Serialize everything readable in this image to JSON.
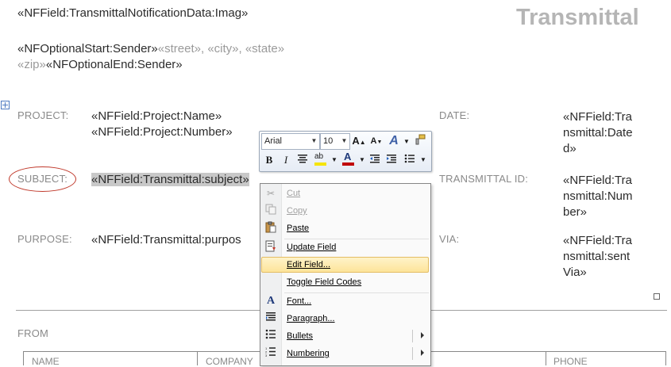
{
  "header": {
    "image_field": "«NFField:TransmittalNotificationData:Imag»",
    "title": "Transmittal",
    "sender_start": "«NFOptionalStart:Sender»",
    "street": "«street»,",
    "city": "«city»,",
    "state": "«state»",
    "zip": "«zip»",
    "sender_end": "«NFOptionalEnd:Sender»"
  },
  "fields": {
    "project_label": "PROJECT:",
    "project_name": "«NFField:Project:Name»",
    "project_number": "«NFField:Project:Number»",
    "subject_label": "SUBJECT:",
    "subject_value": "«NFField:Transmittal:subject»",
    "purpose_label": "PURPOSE:",
    "purpose_value": "«NFField:Transmittal:purpos",
    "date_label": "DATE:",
    "date_value": [
      "«NFField:Tra",
      "nsmittal:Date",
      "d»"
    ],
    "transmittal_id_label": "TRANSMITTAL ID:",
    "transmittal_id_value": [
      "«NFField:Tra",
      "nsmittal:Num",
      "ber»"
    ],
    "via_label": "VIA:",
    "via_value": [
      "«NFField:Tra",
      "nsmittal:sent",
      "Via»"
    ]
  },
  "from": {
    "label": "FROM",
    "columns": [
      "NAME",
      "COMPANY",
      "PHONE"
    ]
  },
  "mini_toolbar": {
    "font": "Arial",
    "size": "10",
    "icons": [
      "grow-font-icon",
      "shrink-font-icon",
      "styles-icon",
      "format-painter-icon",
      "bold-icon",
      "italic-icon",
      "center-icon",
      "highlight-icon",
      "font-color-icon",
      "decrease-indent-icon",
      "increase-indent-icon",
      "bullets-icon"
    ],
    "highlight_color": "#f5e400",
    "font_color": "#c00000"
  },
  "context_menu": {
    "items": [
      {
        "label": "Cut",
        "icon": "scissors-icon",
        "disabled": true
      },
      {
        "label": "Copy",
        "icon": "copy-icon",
        "disabled": true
      },
      {
        "label": "Paste",
        "icon": "paste-icon",
        "disabled": false
      },
      {
        "label": "Update Field",
        "icon": "update-field-icon",
        "disabled": false
      },
      {
        "label": "Edit Field...",
        "icon": "",
        "disabled": false,
        "hover": true
      },
      {
        "label": "Toggle Field Codes",
        "icon": "",
        "disabled": false
      },
      {
        "label": "Font...",
        "icon": "font-icon",
        "disabled": false
      },
      {
        "label": "Paragraph...",
        "icon": "paragraph-icon",
        "disabled": false
      },
      {
        "label": "Bullets",
        "icon": "bullets-icon",
        "disabled": false,
        "submenu": true
      },
      {
        "label": "Numbering",
        "icon": "numbering-icon",
        "disabled": false,
        "submenu": true
      }
    ]
  },
  "colors": {
    "annotation_circle": "#c0392b",
    "menu_hover": "#fde49a",
    "title_gray": "#b5b5b5"
  }
}
